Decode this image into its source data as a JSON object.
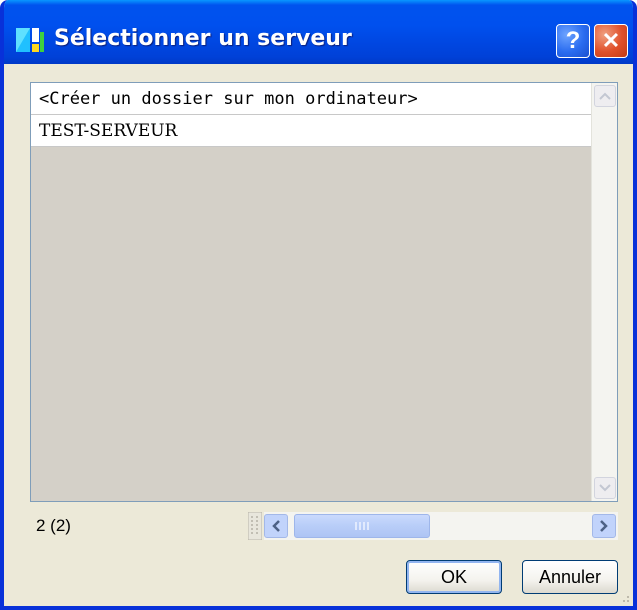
{
  "window": {
    "title": "Sélectionner un serveur",
    "help_glyph": "?",
    "close_glyph": "✕",
    "icon": "app-logo-icon",
    "colors": {
      "titlebar": "#0053ee",
      "frame": "#0831d9",
      "body": "#ece9d8"
    }
  },
  "list": {
    "items": [
      {
        "label": "<Créer un dossier sur mon ordinateur>"
      },
      {
        "label": "TEST-SERVEUR"
      }
    ]
  },
  "status": {
    "count": "2 (2)"
  },
  "buttons": {
    "ok_label": "OK",
    "cancel_label": "Annuler"
  }
}
